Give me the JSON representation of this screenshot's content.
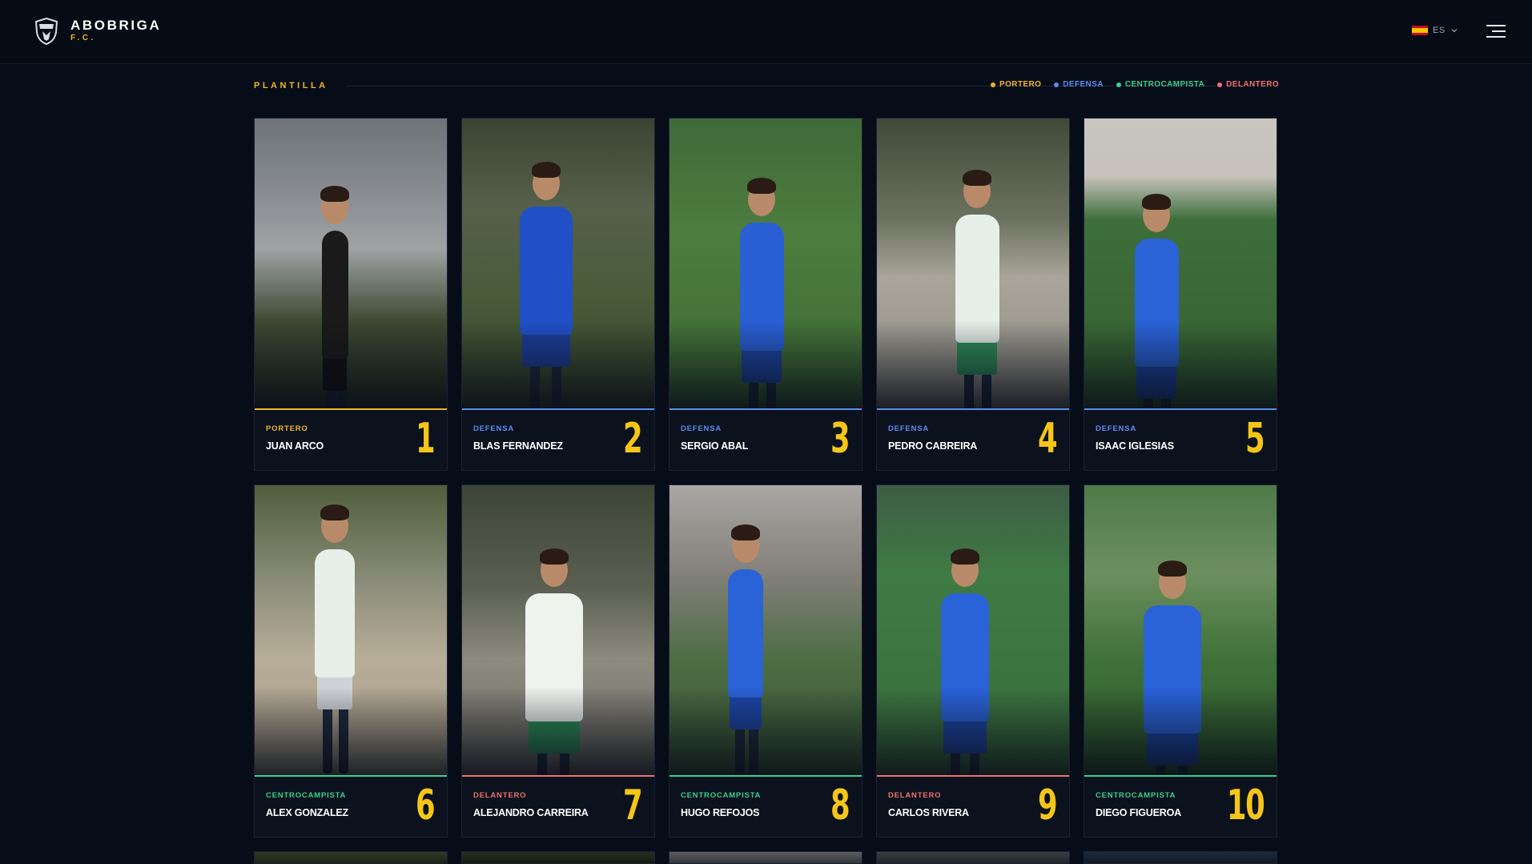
{
  "header": {
    "brand_line1": "ABOBRIGA",
    "brand_line2": "F.C.",
    "lang_code": "ES",
    "crest_icon": "club-crest-icon",
    "menu_icon": "hamburger-menu-icon"
  },
  "section": {
    "title": "PLANTILLA",
    "legend": [
      {
        "label": "PORTERO",
        "color": "#f0b429"
      },
      {
        "label": "DEFENSA",
        "color": "#5b8def"
      },
      {
        "label": "CENTROCAMPISTA",
        "color": "#3ecf8e"
      },
      {
        "label": "DELANTERO",
        "color": "#f07070"
      }
    ]
  },
  "colors": {
    "PORTERO": "#f0b429",
    "DEFENSA": "#5b8def",
    "CENTROCAMPISTA": "#3ecf8e",
    "DELANTERO": "#f07070",
    "number": "#f5c518",
    "background": "#070d18"
  },
  "players": [
    {
      "position": "PORTERO",
      "name": "JUAN ARCO",
      "number": "1",
      "kit": "black"
    },
    {
      "position": "DEFENSA",
      "name": "BLAS FERNANDEZ",
      "number": "2",
      "kit": "blue"
    },
    {
      "position": "DEFENSA",
      "name": "SERGIO ABAL",
      "number": "3",
      "kit": "blue"
    },
    {
      "position": "DEFENSA",
      "name": "PEDRO CABREIRA",
      "number": "4",
      "kit": "green"
    },
    {
      "position": "DEFENSA",
      "name": "ISAAC IGLESIAS",
      "number": "5",
      "kit": "blue"
    },
    {
      "position": "CENTROCAMPISTA",
      "name": "ALEX GONZALEZ",
      "number": "6",
      "kit": "green"
    },
    {
      "position": "DELANTERO",
      "name": "ALEJANDRO CARREIRA",
      "number": "7",
      "kit": "green"
    },
    {
      "position": "CENTROCAMPISTA",
      "name": "HUGO REFOJOS",
      "number": "8",
      "kit": "blue"
    },
    {
      "position": "DELANTERO",
      "name": "CARLOS RIVERA",
      "number": "9",
      "kit": "blue"
    },
    {
      "position": "CENTROCAMPISTA",
      "name": "DIEGO FIGUEROA",
      "number": "10",
      "kit": "blue"
    }
  ]
}
